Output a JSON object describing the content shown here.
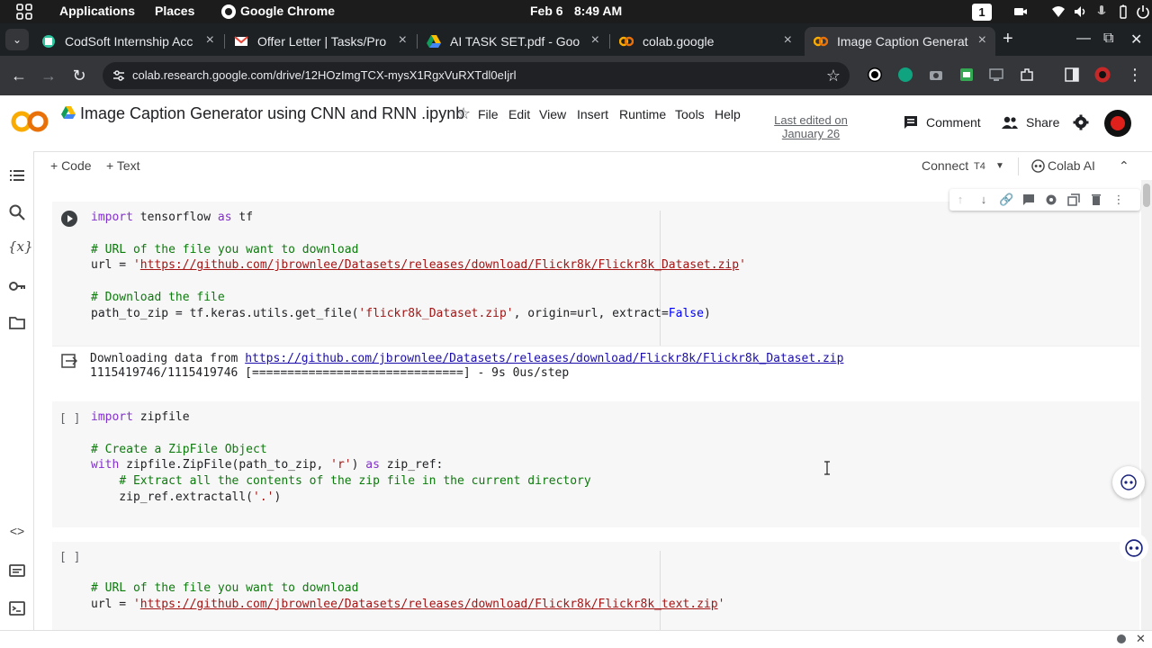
{
  "system_bar": {
    "applications": "Applications",
    "places": "Places",
    "browser": "Google Chrome",
    "date": "Feb 6",
    "time": "8:49 AM",
    "workspace": "1"
  },
  "tabs": [
    {
      "title": "CodSoft Internship Acc",
      "icon": "codsoft-icon"
    },
    {
      "title": "Offer Letter | Tasks/Pro",
      "icon": "gmail-icon"
    },
    {
      "title": "AI TASK SET.pdf - Goo",
      "icon": "drive-icon"
    },
    {
      "title": "colab.google",
      "icon": "colab-icon"
    },
    {
      "title": "Image Caption Generat",
      "icon": "colab-icon",
      "active": true
    }
  ],
  "address_bar": {
    "url": "colab.research.google.com/drive/12HOzImgTCX-mysX1RgxVuRXTdl0eIjrl"
  },
  "colab": {
    "title": "Image Caption Generator using CNN and  RNN .ipynb",
    "menu": [
      "File",
      "Edit",
      "View",
      "Insert",
      "Runtime",
      "Tools",
      "Help"
    ],
    "last_edited_line1": "Last edited on",
    "last_edited_line2": "January 26",
    "comment": "Comment",
    "share": "Share"
  },
  "toolbar": {
    "add_code": "+ Code",
    "add_text": "+ Text",
    "connect": "Connect",
    "runtime_type": "T4",
    "colab_ai": "Colab AI"
  },
  "cells": {
    "c1": {
      "bracket": "",
      "output_line1_prefix": "Downloading data from ",
      "output_line1_link": "https://github.com/jbrownlee/Datasets/releases/download/Flickr8k/Flickr8k_Dataset.zip",
      "output_line2": "1115419746/1115419746 [==============================] - 9s 0us/step"
    },
    "c2": {
      "bracket": "[ ]"
    },
    "c3": {
      "bracket": "[ ]"
    }
  },
  "colors": {
    "keyword": "#8430ce",
    "comment": "#0d7a0d",
    "string": "#a31515",
    "link": "#1a0dab",
    "brand_orange": "#f9ab00"
  }
}
